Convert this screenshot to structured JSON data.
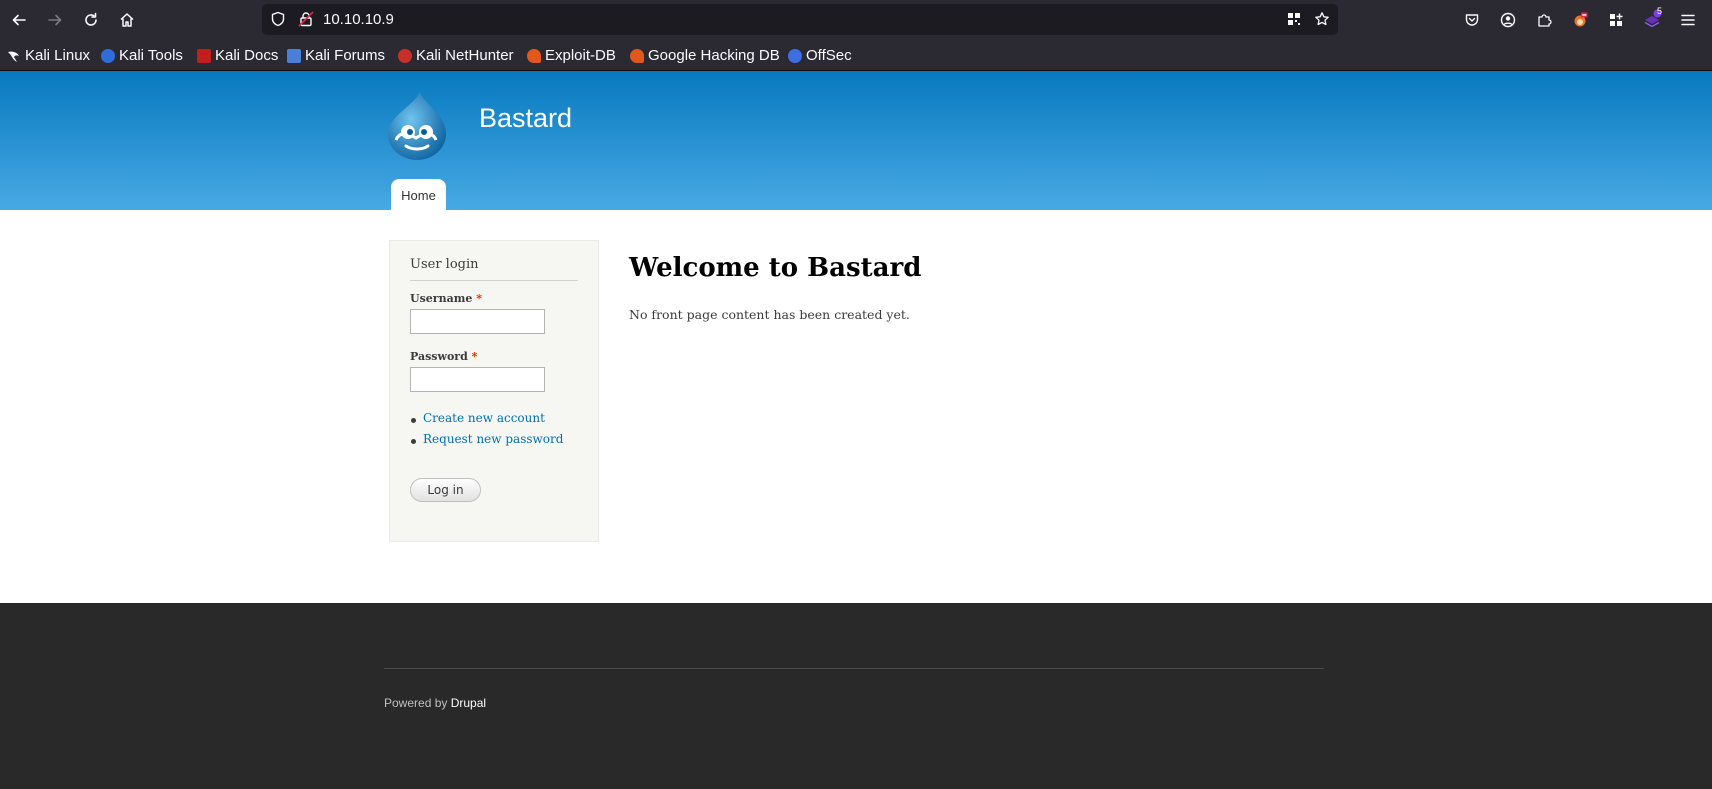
{
  "browser": {
    "url": "10.10.10.9",
    "extension_badge": "5",
    "bookmarks": [
      {
        "label": "Kali Linux",
        "color": "#2b2a33"
      },
      {
        "label": "Kali Tools",
        "color": "#2f6dd8"
      },
      {
        "label": "Kali Docs",
        "color": "#c21e1e"
      },
      {
        "label": "Kali Forums",
        "color": "#4a7fd8"
      },
      {
        "label": "Kali NetHunter",
        "color": "#c9302c"
      },
      {
        "label": "Exploit-DB",
        "color": "#e2581c"
      },
      {
        "label": "Google Hacking DB",
        "color": "#e2581c"
      },
      {
        "label": "OffSec",
        "color": "#3d6fe0"
      }
    ]
  },
  "site": {
    "name": "Bastard",
    "nav": {
      "home": "Home"
    }
  },
  "login": {
    "title": "User login",
    "username_label": "Username",
    "password_label": "Password",
    "required_mark": "*",
    "username_value": "",
    "password_value": "",
    "links": [
      "Create new account",
      "Request new password"
    ],
    "submit": "Log in"
  },
  "content": {
    "title": "Welcome to Bastard",
    "message": "No front page content has been created yet."
  },
  "footer": {
    "powered_by": "Powered by",
    "drupal_link": "Drupal"
  },
  "colors": {
    "header_top": "#0779bf",
    "header_bottom": "#48a9e4",
    "link": "#0071b3",
    "footer_bg": "#292929",
    "browser_bg": "#2b2a33"
  }
}
